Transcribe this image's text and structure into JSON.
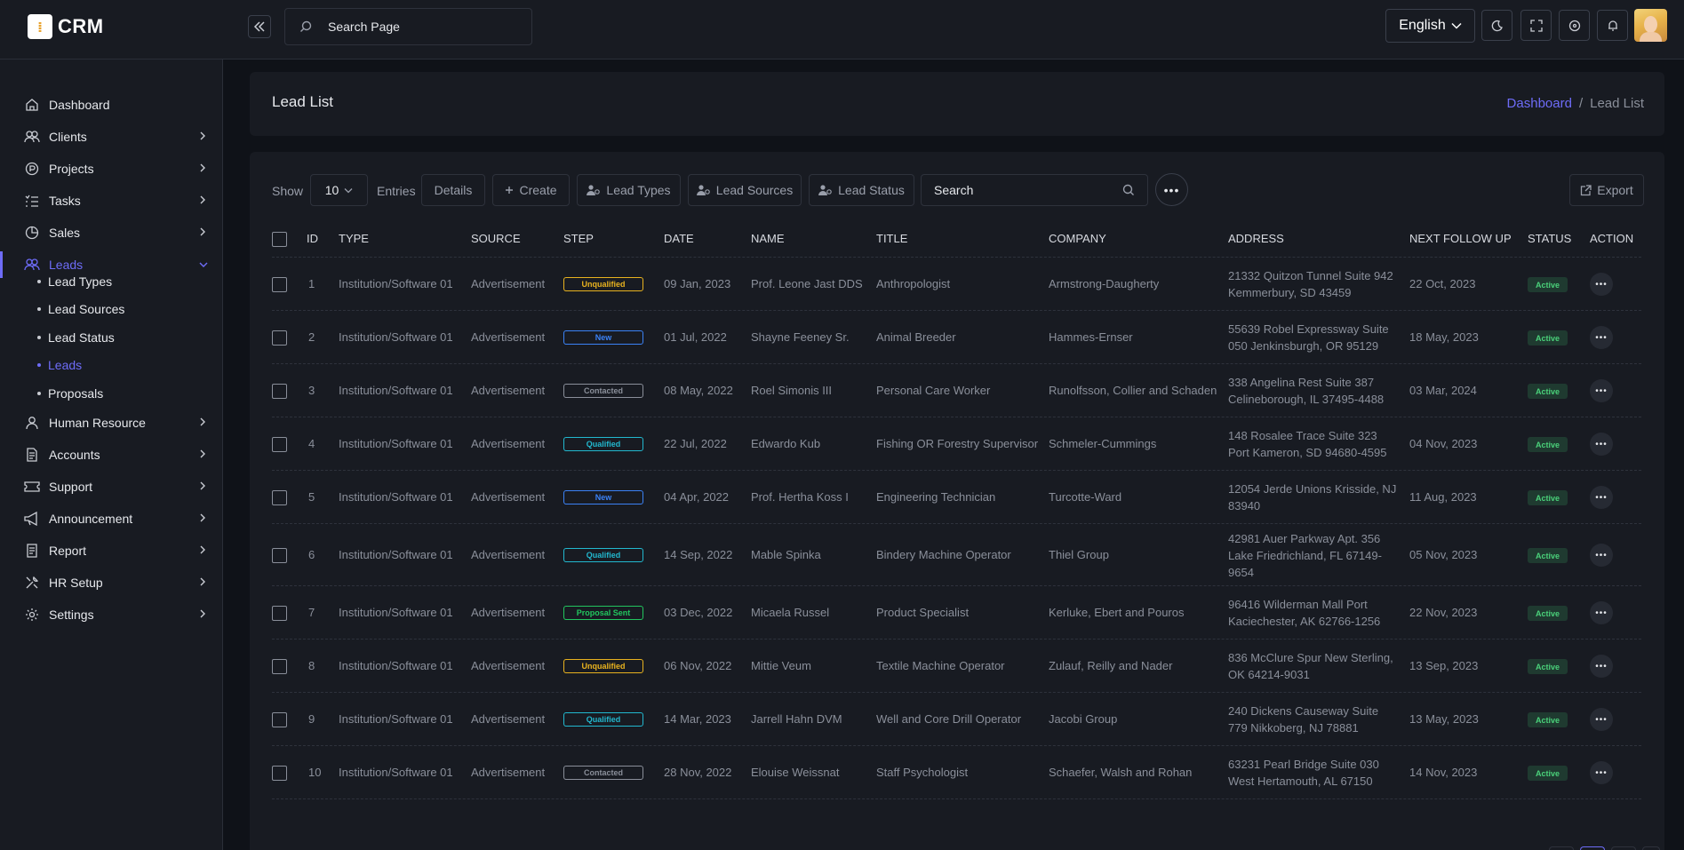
{
  "app": {
    "logo_glyph": "⁞",
    "logo_text": "CRM"
  },
  "topbar": {
    "search_placeholder": "Search Page",
    "language": "English",
    "icons": [
      "moon-icon",
      "fullscreen-icon",
      "dashboard-icon",
      "bell-icon"
    ]
  },
  "sidebar": {
    "items": [
      {
        "label": "Dashboard",
        "icon": "home-icon",
        "has_children": false
      },
      {
        "label": "Clients",
        "icon": "users-icon",
        "has_children": true
      },
      {
        "label": "Projects",
        "icon": "projects-icon",
        "has_children": true
      },
      {
        "label": "Tasks",
        "icon": "tasks-icon",
        "has_children": true
      },
      {
        "label": "Sales",
        "icon": "pie-icon",
        "has_children": true
      },
      {
        "label": "Leads",
        "icon": "users-icon",
        "has_children": true,
        "active": true
      },
      {
        "label": "Human Resource",
        "icon": "user-icon",
        "has_children": true
      },
      {
        "label": "Accounts",
        "icon": "accounts-icon",
        "has_children": true
      },
      {
        "label": "Support",
        "icon": "ticket-icon",
        "has_children": true
      },
      {
        "label": "Announcement",
        "icon": "megaphone-icon",
        "has_children": true
      },
      {
        "label": "Report",
        "icon": "report-icon",
        "has_children": true
      },
      {
        "label": "HR Setup",
        "icon": "tools-icon",
        "has_children": true
      },
      {
        "label": "Settings",
        "icon": "gear-icon",
        "has_children": true
      }
    ],
    "leads_sub": [
      {
        "label": "Lead Types"
      },
      {
        "label": "Lead Sources"
      },
      {
        "label": "Lead Status"
      },
      {
        "label": "Leads",
        "active": true
      },
      {
        "label": "Proposals"
      }
    ]
  },
  "header": {
    "title": "Lead List",
    "breadcrumb_link": "Dashboard",
    "breadcrumb_sep": "/",
    "breadcrumb_current": "Lead List"
  },
  "toolbar": {
    "show": "Show",
    "entries_value": "10",
    "entries": "Entries",
    "details": "Details",
    "create": "Create",
    "lead_types": "Lead Types",
    "lead_sources": "Lead Sources",
    "lead_status": "Lead Status",
    "search_placeholder": "Search",
    "more": "•••",
    "export": "Export"
  },
  "table": {
    "columns": [
      "ID",
      "TYPE",
      "SOURCE",
      "STEP",
      "DATE",
      "NAME",
      "TITLE",
      "COMPANY",
      "ADDRESS",
      "NEXT FOLLOW UP",
      "STATUS",
      "ACTION"
    ],
    "step_colors": {
      "Unqualified": "#e8b21f",
      "New": "#3b82f6",
      "Contacted": "#8a8f9a",
      "Qualified": "#22b8cf",
      "Proposal Sent": "#22c55e"
    },
    "rows": [
      {
        "id": "1",
        "type": "Institution/Software 01",
        "source": "Advertisement",
        "step": "Unqualified",
        "date": "09 Jan, 2023",
        "name": "Prof. Leone Jast DDS",
        "title": "Anthropologist",
        "company": "Armstrong-Daugherty",
        "address": [
          "21332 Quitzon Tunnel Suite 942",
          "Kemmerbury, SD 43459"
        ],
        "follow": "22 Oct, 2023",
        "status": "Active"
      },
      {
        "id": "2",
        "type": "Institution/Software 01",
        "source": "Advertisement",
        "step": "New",
        "date": "01 Jul, 2022",
        "name": "Shayne Feeney Sr.",
        "title": "Animal Breeder",
        "company": "Hammes-Ernser",
        "address": [
          "55639 Robel Expressway Suite",
          "050 Jenkinsburgh, OR 95129"
        ],
        "follow": "18 May, 2023",
        "status": "Active"
      },
      {
        "id": "3",
        "type": "Institution/Software 01",
        "source": "Advertisement",
        "step": "Contacted",
        "date": "08 May, 2022",
        "name": "Roel Simonis III",
        "title": "Personal Care Worker",
        "company": "Runolfsson, Collier and Schaden",
        "address": [
          "338 Angelina Rest Suite 387",
          "Celineborough, IL 37495-4488"
        ],
        "follow": "03 Mar, 2024",
        "status": "Active"
      },
      {
        "id": "4",
        "type": "Institution/Software 01",
        "source": "Advertisement",
        "step": "Qualified",
        "date": "22 Jul, 2022",
        "name": "Edwardo Kub",
        "title": "Fishing OR Forestry Supervisor",
        "company": "Schmeler-Cummings",
        "address": [
          "148 Rosalee Trace Suite 323",
          "Port Kameron, SD 94680-4595"
        ],
        "follow": "04 Nov, 2023",
        "status": "Active"
      },
      {
        "id": "5",
        "type": "Institution/Software 01",
        "source": "Advertisement",
        "step": "New",
        "date": "04 Apr, 2022",
        "name": "Prof. Hertha Koss I",
        "title": "Engineering Technician",
        "company": "Turcotte-Ward",
        "address": [
          "12054 Jerde Unions Krisside, NJ",
          "83940"
        ],
        "follow": "11 Aug, 2023",
        "status": "Active"
      },
      {
        "id": "6",
        "type": "Institution/Software 01",
        "source": "Advertisement",
        "step": "Qualified",
        "date": "14 Sep, 2022",
        "name": "Mable Spinka",
        "title": "Bindery Machine Operator",
        "company": "Thiel Group",
        "address": [
          "42981 Auer Parkway Apt. 356",
          "Lake Friedrichland, FL 67149-",
          "9654"
        ],
        "follow": "05 Nov, 2023",
        "status": "Active"
      },
      {
        "id": "7",
        "type": "Institution/Software 01",
        "source": "Advertisement",
        "step": "Proposal Sent",
        "date": "03 Dec, 2022",
        "name": "Micaela Russel",
        "title": "Product Specialist",
        "company": "Kerluke, Ebert and Pouros",
        "address": [
          "96416 Wilderman Mall Port",
          "Kaciechester, AK 62766-1256"
        ],
        "follow": "22 Nov, 2023",
        "status": "Active"
      },
      {
        "id": "8",
        "type": "Institution/Software 01",
        "source": "Advertisement",
        "step": "Unqualified",
        "date": "06 Nov, 2022",
        "name": "Mittie Veum",
        "title": "Textile Machine Operator",
        "company": "Zulauf, Reilly and Nader",
        "address": [
          "836 McClure Spur New Sterling,",
          "OK 64214-9031"
        ],
        "follow": "13 Sep, 2023",
        "status": "Active"
      },
      {
        "id": "9",
        "type": "Institution/Software 01",
        "source": "Advertisement",
        "step": "Qualified",
        "date": "14 Mar, 2023",
        "name": "Jarrell Hahn DVM",
        "title": "Well and Core Drill Operator",
        "company": "Jacobi Group",
        "address": [
          "240 Dickens Causeway Suite",
          "779 Nikkoberg, NJ 78881"
        ],
        "follow": "13 May, 2023",
        "status": "Active"
      },
      {
        "id": "10",
        "type": "Institution/Software 01",
        "source": "Advertisement",
        "step": "Contacted",
        "date": "28 Nov, 2022",
        "name": "Elouise Weissnat",
        "title": "Staff Psychologist",
        "company": "Schaefer, Walsh and Rohan",
        "address": [
          "63231 Pearl Bridge Suite 030",
          "West Hertamouth, AL 67150"
        ],
        "follow": "14 Nov, 2023",
        "status": "Active"
      }
    ]
  }
}
